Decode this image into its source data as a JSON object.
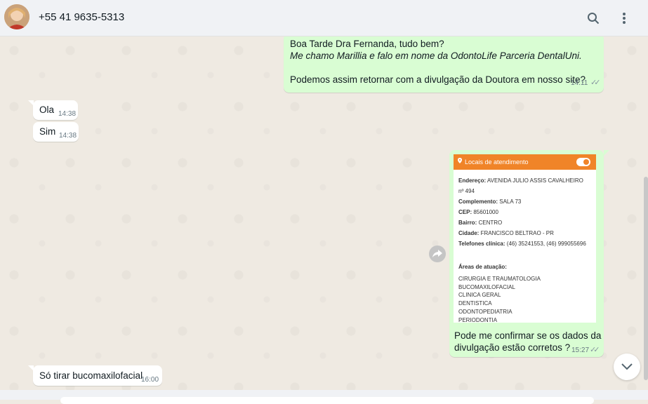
{
  "header": {
    "contact": "+55 41 9635-5313",
    "search_icon": "search-icon",
    "menu_icon": "menu-dots-icon"
  },
  "messages": {
    "m1": {
      "line1": "Boa Tarde Dra Fernanda, tudo bem?",
      "line2": "Me chamo Marillia e falo em nome da OdontoLife Parceria DentalUni.",
      "line3": "Podemos assim retornar com a divulgação da Doutora em nosso site?",
      "time": "14:11"
    },
    "m2": {
      "text": "Ola",
      "time": "14:38"
    },
    "m3": {
      "text": "Sim",
      "time": "14:38"
    },
    "m4": {
      "card": {
        "title": "Locais de atendimento",
        "endereco_label": "Endereço:",
        "endereco_value": "AVENIDA JULIO ASSIS CAVALHEIRO",
        "endereco_cont": "nº 494",
        "complemento_label": "Complemento:",
        "complemento_value": "SALA 73",
        "cep_label": "CEP:",
        "cep_value": "85601000",
        "bairro_label": "Bairro:",
        "bairro_value": "CENTRO",
        "cidade_label": "Cidade:",
        "cidade_value": "FRANCISCO BELTRAO - PR",
        "telefones_label": "Telefones clínica:",
        "telefones_value": "(46) 35241553, (46) 999055696",
        "areas_label": "Áreas de atuação:",
        "areas": [
          "CIRURGIA E TRAUMATOLOGIA",
          "BUCOMAXILOFACIAL",
          "CLINICA GERAL",
          "DENTISTICA",
          "ODONTOPEDIATRIA",
          "PERIODONTIA"
        ]
      },
      "caption_line1": "Pode me confirmar se os dados da",
      "caption_line2": "divulgação estão corretos ?",
      "time": "15:27"
    },
    "m5": {
      "text": "Só tirar bucomaxilofacial",
      "time": "16:00"
    }
  },
  "colors": {
    "outgoing": "#d9fdd3",
    "incoming": "#ffffff",
    "card_header": "#f08428",
    "background": "#efeae2"
  }
}
